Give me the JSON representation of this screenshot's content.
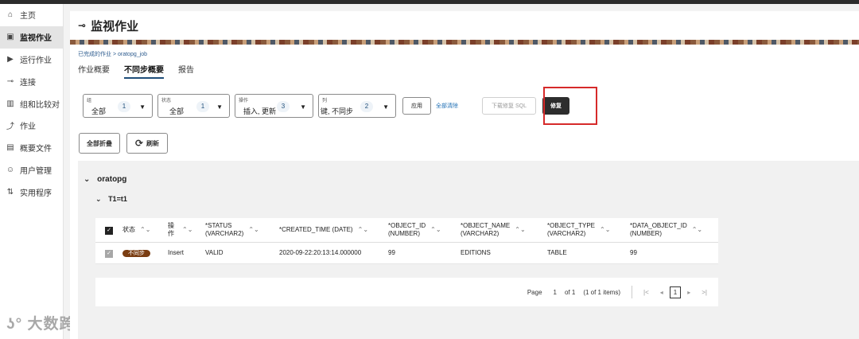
{
  "sidebar": {
    "items": [
      {
        "icon": "home-icon",
        "glyph": "⌂",
        "label": "主页"
      },
      {
        "icon": "monitor-job-icon",
        "glyph": "▣",
        "label": "监视作业"
      },
      {
        "icon": "run-job-icon",
        "glyph": "▶",
        "label": "运行作业"
      },
      {
        "icon": "connection-icon",
        "glyph": "⊸",
        "label": "连接"
      },
      {
        "icon": "compare-icon",
        "glyph": "▥",
        "label": "组和比较对"
      },
      {
        "icon": "job-icon",
        "glyph": "⤴",
        "label": "作业"
      },
      {
        "icon": "profile-icon",
        "glyph": "▤",
        "label": "概要文件"
      },
      {
        "icon": "user-icon",
        "glyph": "☺",
        "label": "用户管理"
      },
      {
        "icon": "utility-icon",
        "glyph": "⇅",
        "label": "实用程序"
      }
    ],
    "active_index": 1
  },
  "header": {
    "title": "监视作业",
    "icon": "connection-icon"
  },
  "breadcrumb": {
    "parent": "已完成的作业",
    "sep": ">",
    "current": "oratopg_job"
  },
  "tabs": [
    "作业概要",
    "不同步概要",
    "报告"
  ],
  "active_tab": 1,
  "filters": {
    "group": {
      "label": "组",
      "value": "全部",
      "count": "1"
    },
    "status": {
      "label": "状态",
      "value": "全部",
      "count": "1"
    },
    "operation": {
      "label": "操作",
      "value": "插入, 更新",
      "count": "3"
    },
    "column": {
      "label": "列",
      "value": "键, 不同步",
      "count": "2"
    },
    "apply_label": "应用",
    "clear_all_label": "全部清除",
    "download_sql_label": "下载修复 SQL",
    "repair_label": "修复"
  },
  "actions": {
    "collapse_all_label": "全部折叠",
    "refresh_label": "刷新"
  },
  "groups": {
    "group_name": "oratopg",
    "pair_name": "T1=t1"
  },
  "table": {
    "columns": [
      "状态",
      "操作",
      "*STATUS\n(VARCHAR2)",
      "*CREATED_TIME (DATE)",
      "*OBJECT_ID\n(NUMBER)",
      "*OBJECT_NAME\n(VARCHAR2)",
      "*OBJECT_TYPE\n(VARCHAR2)",
      "*DATA_OBJECT_ID\n(NUMBER)"
    ],
    "rows": [
      {
        "status": "不同步",
        "operation": "Insert",
        "cells": [
          "VALID",
          "2020-09-22:20:13:14.000000",
          "99",
          "EDITIONS",
          "TABLE",
          "99"
        ]
      }
    ]
  },
  "pager": {
    "page_label": "Page",
    "page": "1",
    "of_label": "of 1",
    "items_label": "(1 of 1 items)",
    "current": "1"
  },
  "watermark": "大数跨境",
  "colors": {
    "accent": "#1f4e79",
    "badge": "#7a3d12",
    "highlight": "#d62a2a",
    "dark_button": "#2d2d2d"
  }
}
